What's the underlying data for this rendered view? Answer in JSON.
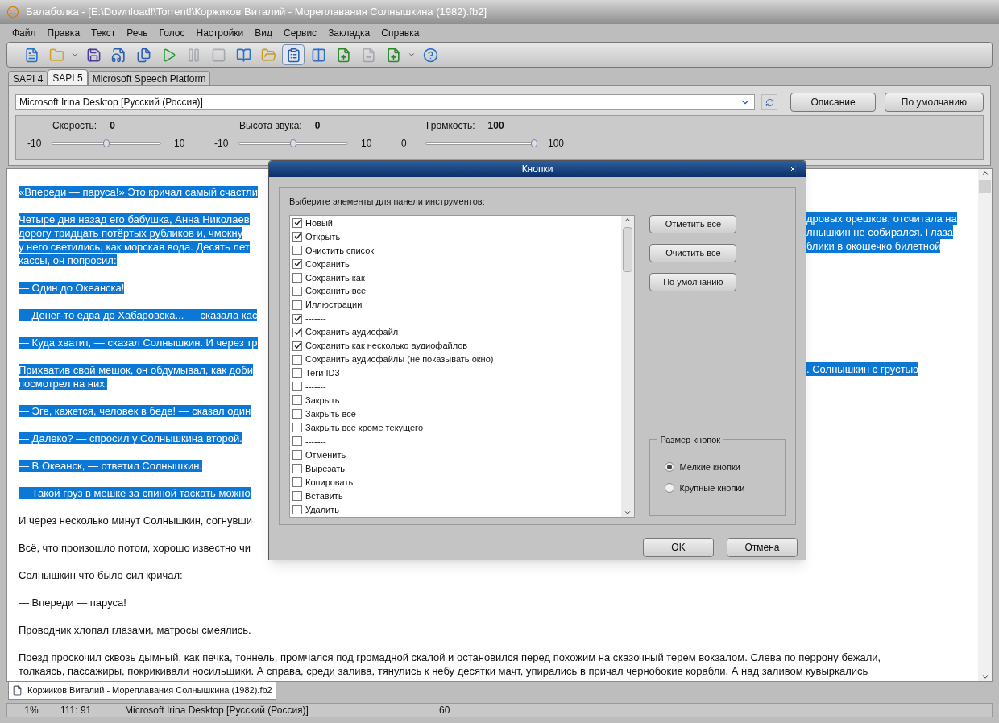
{
  "window": {
    "title": "Балаболка - [E:\\Download!\\Torrent!\\Коржиков Виталий - Мореплавания Солнышкина (1982).fb2]"
  },
  "menu": [
    "Файл",
    "Правка",
    "Текст",
    "Речь",
    "Голос",
    "Настройки",
    "Вид",
    "Сервис",
    "Закладка",
    "Справка"
  ],
  "toolbar": [
    {
      "kind": "new",
      "disabled": false,
      "pressed": false
    },
    {
      "kind": "open",
      "disabled": false,
      "pressed": false
    },
    {
      "kind": "dropdown",
      "disabled": false,
      "pressed": false
    },
    {
      "kind": "save",
      "disabled": false,
      "pressed": false
    },
    {
      "kind": "audio",
      "disabled": false,
      "pressed": false
    },
    {
      "kind": "audio-multi",
      "disabled": false,
      "pressed": false
    },
    {
      "kind": "play",
      "disabled": false,
      "pressed": false
    },
    {
      "kind": "pause",
      "disabled": true,
      "pressed": false
    },
    {
      "kind": "stop",
      "disabled": true,
      "pressed": false
    },
    {
      "kind": "book",
      "disabled": false,
      "pressed": false
    },
    {
      "kind": "folder-play",
      "disabled": false,
      "pressed": false
    },
    {
      "kind": "clipboard",
      "disabled": false,
      "pressed": true
    },
    {
      "kind": "columns",
      "disabled": false,
      "pressed": false
    },
    {
      "kind": "add-file",
      "disabled": false,
      "pressed": false
    },
    {
      "kind": "remove-file",
      "disabled": true,
      "pressed": false
    },
    {
      "kind": "add-file",
      "disabled": false,
      "pressed": false
    },
    {
      "kind": "dropdown",
      "disabled": false,
      "pressed": false
    },
    {
      "kind": "help",
      "disabled": false,
      "pressed": false
    }
  ],
  "engine_tabs": [
    {
      "label": "SAPI 4",
      "selected": false
    },
    {
      "label": "SAPI 5",
      "selected": true
    },
    {
      "label": "Microsoft Speech Platform",
      "selected": false
    }
  ],
  "voice": {
    "value": "Microsoft Irina Desktop [Русский (Россия)]",
    "buttons": [
      "Описание",
      "По умолчанию"
    ]
  },
  "sliders": [
    {
      "label": "Скорость:",
      "value": "0",
      "min": "-10",
      "max": "10",
      "level": 0.5
    },
    {
      "label": "Высота звука:",
      "value": "0",
      "min": "-10",
      "max": "10",
      "level": 0.5
    },
    {
      "label": "Громкость:",
      "value": "100",
      "min": "0",
      "max": "100",
      "level": 1
    }
  ],
  "document": {
    "paragraphs": [
      {
        "selected": true,
        "lines": [
          {
            "left": "«Впереди — паруса!» Это кричал самый счастли"
          }
        ]
      },
      {
        "selected": true,
        "lines": [
          {
            "left": "Четыре дня назад его бабушка, Анна Николаев",
            "right": "дровых орешков, отсчитала на"
          },
          {
            "left": "дорогу тридцать потёртых рубликов и, чмокну",
            "right": "лнышкин не собирался. Глаза"
          },
          {
            "left": "у него светились, как морская вода. Десять лет",
            "right": "блики в окошечко билетной"
          },
          {
            "left": "кассы, он попросил:"
          }
        ]
      },
      {
        "selected": true,
        "lines": [
          {
            "left": "— Один до Океанска!"
          }
        ]
      },
      {
        "selected": true,
        "lines": [
          {
            "left": "— Денег-то едва до Хабаровска... — сказала кас"
          }
        ]
      },
      {
        "selected": true,
        "lines": [
          {
            "left": "— Куда хватит, — сказал Солнышкин. И через тр"
          }
        ]
      },
      {
        "selected": true,
        "lines": [
          {
            "left": "Прихватив свой мешок, он обдумывал, как доби",
            "right": ". Солнышкин с грустью"
          },
          {
            "left": "посмотрел на них."
          }
        ]
      },
      {
        "selected": true,
        "lines": [
          {
            "left": "— Эге, кажется, человек в беде! — сказал один"
          }
        ]
      },
      {
        "selected": true,
        "lines": [
          {
            "left": "— Далеко? — спросил у Солнышкина второй."
          }
        ]
      },
      {
        "selected": true,
        "lines": [
          {
            "left": "— В Океанск, — ответил Солнышкин."
          }
        ]
      },
      {
        "selected": true,
        "lines": [
          {
            "left": "— Такой груз в мешке за спиной таскать можно"
          }
        ]
      },
      {
        "selected": false,
        "lines": [
          {
            "left": "И через несколько минут Солнышкин, согнувши"
          }
        ]
      },
      {
        "selected": false,
        "lines": [
          {
            "left": "Всё, что произошло потом, хорошо известно чи"
          }
        ]
      },
      {
        "selected": false,
        "lines": [
          {
            "left": "Солнышкин что было сил кричал:"
          }
        ]
      },
      {
        "selected": false,
        "lines": [
          {
            "left": "— Впереди — паруса!"
          }
        ]
      },
      {
        "selected": false,
        "lines": [
          {
            "left": "Проводник хлопал глазами, матросы смеялись."
          }
        ]
      },
      {
        "selected": false,
        "lines": [
          {
            "left": "Поезд проскочил сквозь дымный, как печка, тоннель, промчался под громадной скалой и остановился перед похожим на сказочный терем вокзалом. Слева по перрону бежали,"
          },
          {
            "left": "толкаясь, пассажиры, покрикивали носильщики. А справа, среди залива, тянулись к небу десятки мачт, упирались в причал чернобокие корабли. А над заливом кувыркались"
          }
        ]
      }
    ]
  },
  "document_tabs": [
    {
      "label": "Коржиков Виталий - Мореплавания Солнышкина (1982).fb2",
      "selected": true
    }
  ],
  "status_bar": [
    "1%",
    "111:  91",
    "Microsoft Irina Desktop [Русский (Россия)]",
    "60"
  ],
  "dialog": {
    "title": "Кнопки",
    "prompt": "Выберите элементы для панели инструментов:",
    "items": [
      {
        "label": "Новый",
        "checked": true
      },
      {
        "label": "Открыть",
        "checked": true
      },
      {
        "label": "Очистить список",
        "checked": false
      },
      {
        "label": "Сохранить",
        "checked": true
      },
      {
        "label": "Сохранить как",
        "checked": false
      },
      {
        "label": "Сохранить все",
        "checked": false
      },
      {
        "label": "Иллюстрации",
        "checked": false
      },
      {
        "label": "-------",
        "checked": true
      },
      {
        "label": "Сохранить аудиофайл",
        "checked": true
      },
      {
        "label": "Сохранить как несколько аудиофайлов",
        "checked": true
      },
      {
        "label": "Сохранить аудиофайлы (не показывать окно)",
        "checked": false
      },
      {
        "label": "Теги ID3",
        "checked": false
      },
      {
        "label": "-------",
        "checked": false
      },
      {
        "label": "Закрыть",
        "checked": false
      },
      {
        "label": "Закрыть все",
        "checked": false
      },
      {
        "label": "Закрыть все кроме текущего",
        "checked": false
      },
      {
        "label": "-------",
        "checked": false
      },
      {
        "label": "Отменить",
        "checked": false
      },
      {
        "label": "Вырезать",
        "checked": false
      },
      {
        "label": "Копировать",
        "checked": false
      },
      {
        "label": "Вставить",
        "checked": false
      },
      {
        "label": "Удалить",
        "checked": false
      }
    ],
    "side_buttons": [
      "Отметить все",
      "Очистить все",
      "По умолчанию"
    ],
    "size_group": {
      "title": "Размер кнопок",
      "options": [
        {
          "label": "Мелкие кнопки",
          "selected": true
        },
        {
          "label": "Крупные кнопки",
          "selected": false
        }
      ]
    },
    "buttons": [
      "OK",
      "Отмена"
    ]
  }
}
